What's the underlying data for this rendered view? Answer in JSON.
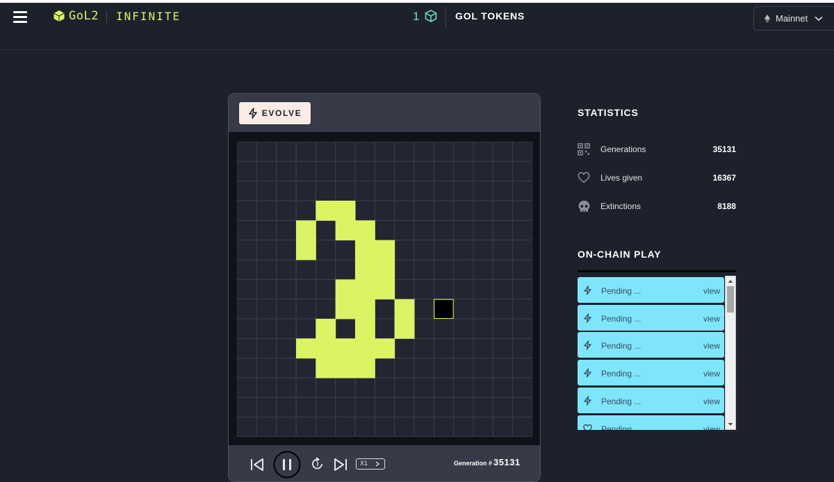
{
  "header": {
    "logo_text": "GoL2",
    "app_name": "INFINITE",
    "token_count": "1",
    "tokens_label": "GOL TOKENS",
    "network": "Mainnet",
    "menu_icon": "hamburger-menu-icon",
    "token_icon": "cube-icon",
    "network_icon": "ethereum-icon"
  },
  "game": {
    "evolve_label": "EVOLVE",
    "generation_label": "Generation #",
    "generation_value": "35131",
    "speed_label": "X1",
    "grid_cols": 15,
    "grid_rows": 15,
    "live_cells": [
      [
        3,
        4
      ],
      [
        3,
        5
      ],
      [
        4,
        3
      ],
      [
        4,
        5
      ],
      [
        4,
        6
      ],
      [
        5,
        3
      ],
      [
        5,
        6
      ],
      [
        5,
        7
      ],
      [
        6,
        6
      ],
      [
        6,
        7
      ],
      [
        7,
        5
      ],
      [
        7,
        6
      ],
      [
        7,
        7
      ],
      [
        8,
        5
      ],
      [
        8,
        6
      ],
      [
        8,
        8
      ],
      [
        9,
        4
      ],
      [
        9,
        6
      ],
      [
        9,
        8
      ],
      [
        10,
        3
      ],
      [
        10,
        4
      ],
      [
        10,
        5
      ],
      [
        10,
        6
      ],
      [
        10,
        7
      ],
      [
        11,
        4
      ],
      [
        11,
        5
      ],
      [
        11,
        6
      ]
    ],
    "selected_cell": [
      8,
      10
    ],
    "colors": {
      "live": "#dcf364",
      "dead": "#232632",
      "grid_line": "#3d4150",
      "selected_border": "#dcf364",
      "selected_fill": "#000000"
    }
  },
  "statistics": {
    "title": "STATISTICS",
    "rows": [
      {
        "label": "Generations",
        "value": "35131",
        "icon": "qr-grid-icon"
      },
      {
        "label": "Lives given",
        "value": "16367",
        "icon": "heart-icon"
      },
      {
        "label": "Extinctions",
        "value": "8188",
        "icon": "skull-icon"
      }
    ]
  },
  "onchain": {
    "title": "ON-CHAIN PLAY",
    "items": [
      {
        "label": "Pending ...",
        "action": "view",
        "icon": "bolt-icon"
      },
      {
        "label": "Pending ...",
        "action": "view",
        "icon": "bolt-icon"
      },
      {
        "label": "Pending ...",
        "action": "view",
        "icon": "bolt-icon"
      },
      {
        "label": "Pending ...",
        "action": "view",
        "icon": "bolt-icon"
      },
      {
        "label": "Pending ...",
        "action": "view",
        "icon": "bolt-icon"
      },
      {
        "label": "Pending ...",
        "action": "view",
        "icon": "heart-icon"
      }
    ]
  }
}
